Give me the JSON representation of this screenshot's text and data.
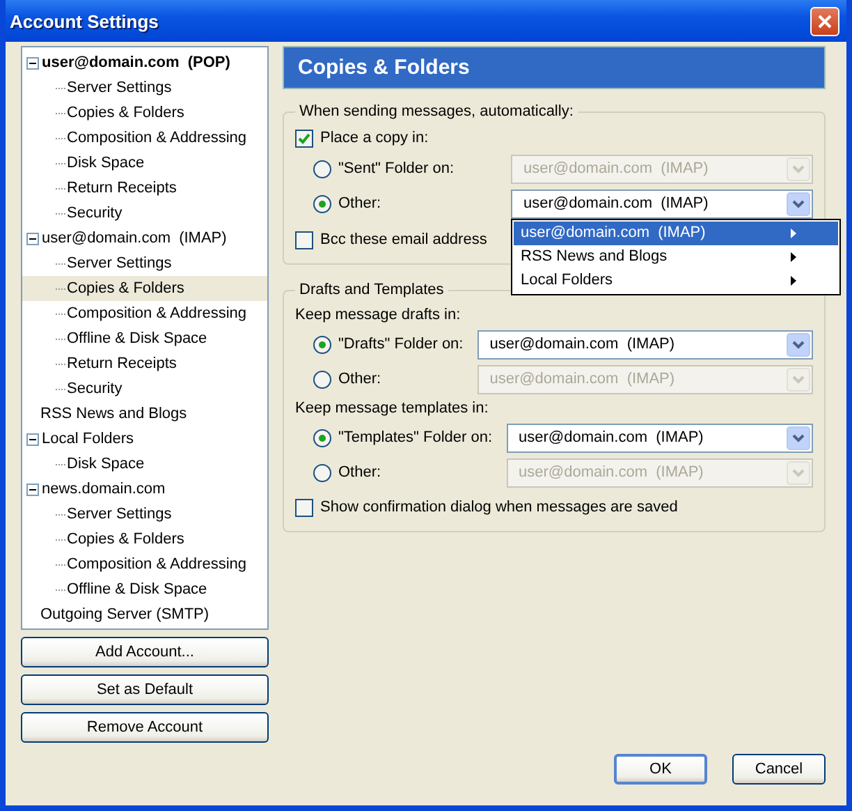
{
  "window": {
    "title": "Account Settings"
  },
  "tree": [
    {
      "label": "user@domain.com  (POP)",
      "bold": true,
      "expanded": true,
      "selected": false,
      "children": [
        {
          "label": "Server Settings",
          "selected": false
        },
        {
          "label": "Copies & Folders",
          "selected": false
        },
        {
          "label": "Composition & Addressing",
          "selected": false
        },
        {
          "label": "Disk Space",
          "selected": false
        },
        {
          "label": "Return Receipts",
          "selected": false
        },
        {
          "label": "Security",
          "selected": false
        }
      ]
    },
    {
      "label": "user@domain.com  (IMAP)",
      "bold": false,
      "expanded": true,
      "selected": false,
      "children": [
        {
          "label": "Server Settings",
          "selected": false
        },
        {
          "label": "Copies & Folders",
          "selected": true
        },
        {
          "label": "Composition & Addressing",
          "selected": false
        },
        {
          "label": "Offline & Disk Space",
          "selected": false
        },
        {
          "label": "Return Receipts",
          "selected": false
        },
        {
          "label": "Security",
          "selected": false
        }
      ]
    },
    {
      "label": "RSS News and Blogs",
      "bold": false,
      "selected": false
    },
    {
      "label": "Local Folders",
      "bold": false,
      "expanded": true,
      "selected": false,
      "children": [
        {
          "label": "Disk Space",
          "selected": false
        }
      ]
    },
    {
      "label": "news.domain.com",
      "bold": false,
      "expanded": true,
      "selected": false,
      "children": [
        {
          "label": "Server Settings",
          "selected": false
        },
        {
          "label": "Copies & Folders",
          "selected": false
        },
        {
          "label": "Composition & Addressing",
          "selected": false
        },
        {
          "label": "Offline & Disk Space",
          "selected": false
        }
      ]
    },
    {
      "label": "Outgoing Server (SMTP)",
      "bold": false,
      "selected": false
    }
  ],
  "account_buttons": [
    "Add Account...",
    "Set as Default",
    "Remove Account"
  ],
  "header": {
    "title": "Copies & Folders"
  },
  "sending": {
    "legend": "When sending messages, automatically:",
    "place_copy": {
      "label": "Place a copy in:",
      "checked": true
    },
    "options": [
      {
        "label": "\"Sent\" Folder on:",
        "selected": false,
        "dropdown": {
          "value": "user@domain.com  (IMAP)",
          "disabled": true
        }
      },
      {
        "label": "Other:",
        "selected": true,
        "dropdown": {
          "value": "user@domain.com  (IMAP)",
          "disabled": false,
          "open": true
        }
      }
    ],
    "bcc": {
      "label": "Bcc these email address",
      "checked": false
    }
  },
  "menu": {
    "items": [
      {
        "label": "user@domain.com  (IMAP)",
        "selected": true
      },
      {
        "label": "RSS News and Blogs",
        "selected": false
      },
      {
        "label": "Local Folders",
        "selected": false
      }
    ]
  },
  "drafts": {
    "legend": "Drafts and Templates",
    "sections": [
      {
        "heading": "Keep message drafts in:",
        "options": [
          {
            "label": "\"Drafts\" Folder on:",
            "selected": true,
            "dropdown": {
              "value": "user@domain.com  (IMAP)",
              "disabled": false
            }
          },
          {
            "label": "Other:",
            "selected": false,
            "dropdown": {
              "value": "user@domain.com  (IMAP)",
              "disabled": true
            }
          }
        ]
      },
      {
        "heading": "Keep message templates in:",
        "options": [
          {
            "label": "\"Templates\" Folder on:",
            "selected": true,
            "dropdown": {
              "value": "user@domain.com  (IMAP)",
              "disabled": false
            }
          },
          {
            "label": "Other:",
            "selected": false,
            "dropdown": {
              "value": "user@domain.com  (IMAP)",
              "disabled": true
            }
          }
        ]
      }
    ],
    "confirm": {
      "label": "Show confirmation dialog when messages are saved",
      "checked": false
    }
  },
  "dialog_buttons": [
    "OK",
    "Cancel"
  ]
}
